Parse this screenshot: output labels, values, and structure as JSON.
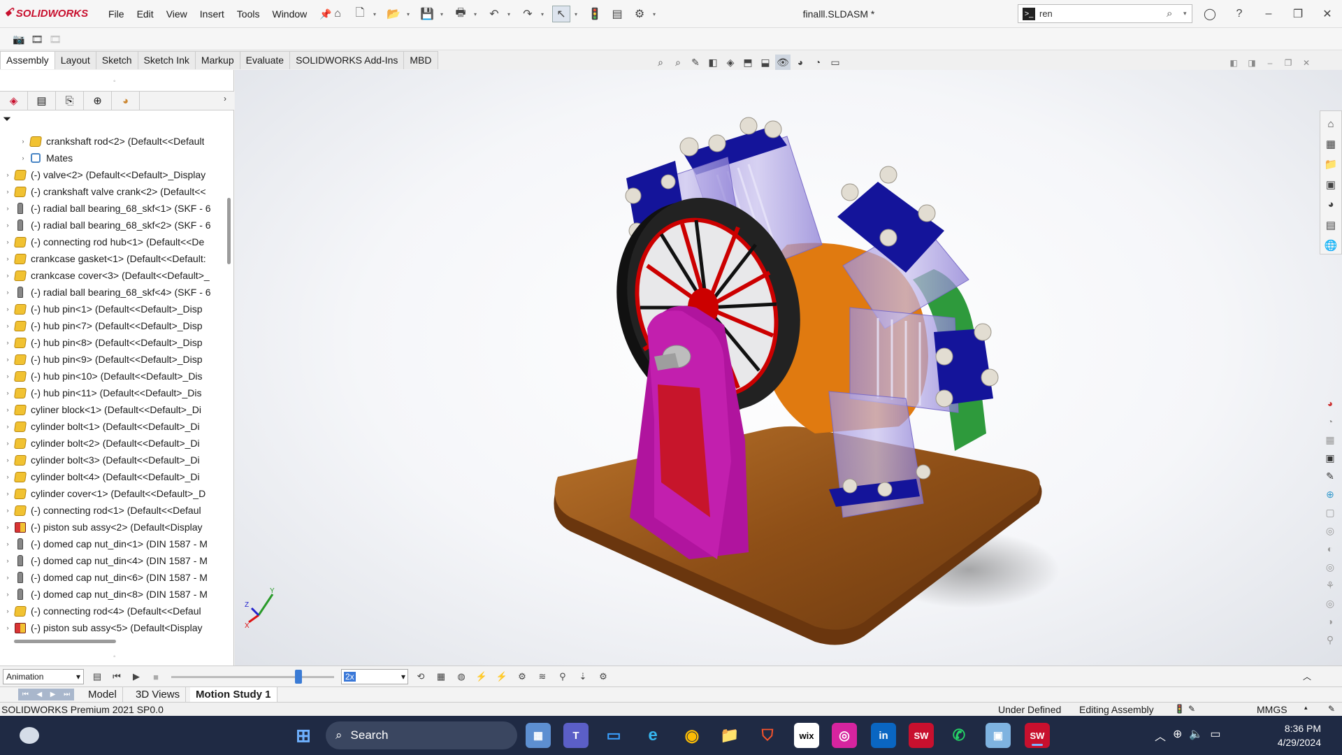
{
  "app": {
    "brand": "SOLIDWORKS",
    "document_title": "finalll.SLDASM *"
  },
  "menu": [
    "File",
    "Edit",
    "View",
    "Insert",
    "Tools",
    "Window"
  ],
  "search": {
    "value": "ren",
    "icon": "search-icon"
  },
  "command_tabs": [
    {
      "label": "Assembly",
      "active": true
    },
    {
      "label": "Layout"
    },
    {
      "label": "Sketch"
    },
    {
      "label": "Sketch Ink"
    },
    {
      "label": "Markup"
    },
    {
      "label": "Evaluate"
    },
    {
      "label": "SOLIDWORKS Add-Ins"
    },
    {
      "label": "MBD"
    }
  ],
  "tree": [
    {
      "label": "crankshaft rod<2> (Default<<Default",
      "icon": "part",
      "indent": 1
    },
    {
      "label": "Mates",
      "icon": "mates",
      "indent": 1
    },
    {
      "label": "(-) valve<2> (Default<<Default>_Display",
      "icon": "part",
      "indent": 0
    },
    {
      "label": "(-) crankshaft valve crank<2> (Default<<",
      "icon": "part",
      "indent": 0
    },
    {
      "label": "(-) radial ball bearing_68_skf<1> (SKF - 6",
      "icon": "bolt",
      "indent": 0
    },
    {
      "label": "(-) radial ball bearing_68_skf<2> (SKF - 6",
      "icon": "bolt",
      "indent": 0
    },
    {
      "label": "(-) connecting rod hub<1> (Default<<De",
      "icon": "part",
      "indent": 0
    },
    {
      "label": "crankcase gasket<1> (Default<<Default:",
      "icon": "part",
      "indent": 0
    },
    {
      "label": "crankcase cover<3> (Default<<Default>_",
      "icon": "part",
      "indent": 0
    },
    {
      "label": "(-) radial ball bearing_68_skf<4> (SKF - 6",
      "icon": "bolt",
      "indent": 0
    },
    {
      "label": "(-) hub pin<1> (Default<<Default>_Disp",
      "icon": "part",
      "indent": 0
    },
    {
      "label": "(-) hub pin<7> (Default<<Default>_Disp",
      "icon": "part",
      "indent": 0
    },
    {
      "label": "(-) hub pin<8> (Default<<Default>_Disp",
      "icon": "part",
      "indent": 0
    },
    {
      "label": "(-) hub pin<9> (Default<<Default>_Disp",
      "icon": "part",
      "indent": 0
    },
    {
      "label": "(-) hub pin<10> (Default<<Default>_Dis",
      "icon": "part",
      "indent": 0
    },
    {
      "label": "(-) hub pin<11> (Default<<Default>_Dis",
      "icon": "part",
      "indent": 0
    },
    {
      "label": "cyliner block<1> (Default<<Default>_Di",
      "icon": "part",
      "indent": 0
    },
    {
      "label": "cylinder bolt<1> (Default<<Default>_Di",
      "icon": "part",
      "indent": 0
    },
    {
      "label": "cylinder bolt<2> (Default<<Default>_Di",
      "icon": "part",
      "indent": 0
    },
    {
      "label": "cylinder bolt<3> (Default<<Default>_Di",
      "icon": "part",
      "indent": 0
    },
    {
      "label": "cylinder bolt<4> (Default<<Default>_Di",
      "icon": "part",
      "indent": 0
    },
    {
      "label": "cylinder cover<1> (Default<<Default>_D",
      "icon": "part",
      "indent": 0
    },
    {
      "label": "(-) connecting rod<1> (Default<<Defaul",
      "icon": "part",
      "indent": 0
    },
    {
      "label": "(-) piston sub assy<2> (Default<Display",
      "icon": "assembly",
      "indent": 0
    },
    {
      "label": "(-) domed cap nut_din<1> (DIN 1587 - M",
      "icon": "bolt",
      "indent": 0
    },
    {
      "label": "(-) domed cap nut_din<4> (DIN 1587 - M",
      "icon": "bolt",
      "indent": 0
    },
    {
      "label": "(-) domed cap nut_din<6> (DIN 1587 - M",
      "icon": "bolt",
      "indent": 0
    },
    {
      "label": "(-) domed cap nut_din<8> (DIN 1587 - M",
      "icon": "bolt",
      "indent": 0
    },
    {
      "label": "(-) connecting rod<4> (Default<<Defaul",
      "icon": "part",
      "indent": 0
    },
    {
      "label": "(-) piston sub assy<5> (Default<Display",
      "icon": "assembly",
      "indent": 0
    }
  ],
  "motion": {
    "study_type": "Animation",
    "speed": "2x",
    "timeline_position": 0.78
  },
  "bottom_tabs": [
    {
      "label": "Model"
    },
    {
      "label": "3D Views"
    },
    {
      "label": "Motion Study 1",
      "active": true
    }
  ],
  "status": {
    "product": "SOLIDWORKS Premium 2021 SP0.0",
    "state": "Under Defined",
    "mode": "Editing Assembly",
    "units": "MMGS"
  },
  "taskbar": {
    "search_label": "Search",
    "time": "8:36 PM",
    "date": "4/29/2024",
    "apps": [
      "wix",
      "in",
      "SW",
      "SW"
    ]
  },
  "triad": {
    "x": "X",
    "y": "Y",
    "z": "Z"
  },
  "colors": {
    "brand": "#c8102e",
    "taskbar": "#1f2a44",
    "wood": "#9b5a1e",
    "cylinder_cap": "#14149a",
    "crankcase": "#e07a10",
    "flywheel": "#1a1a1a",
    "stand": "#b0149e"
  }
}
